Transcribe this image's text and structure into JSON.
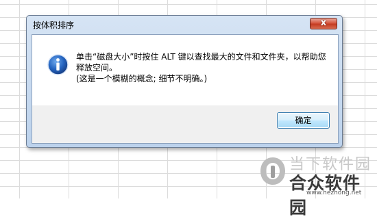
{
  "dialog": {
    "title": "按体积排序",
    "close_label": "x",
    "message_line1": "单击“磁盘大小”时按住 ALT 键以查找最大的文件和文件夹，以帮助您",
    "message_line2": "释放空间。",
    "message_line3": "(这是一个模糊的概念; 细节不明确。)",
    "ok_label": "确定",
    "icon": "info-icon"
  },
  "watermark": {
    "line1": "当下软件园",
    "line2": "合众软件园",
    "line3": "www.hezhong.net",
    "logo_icon": "hezhong-logo-icon"
  },
  "colors": {
    "title_gradient_top": "#d6e4f4",
    "title_gradient_bottom": "#bcd2ec",
    "close_button": "#c43c22",
    "info_icon": "#1f5fb3",
    "ok_button_border": "#3c7fb1"
  }
}
